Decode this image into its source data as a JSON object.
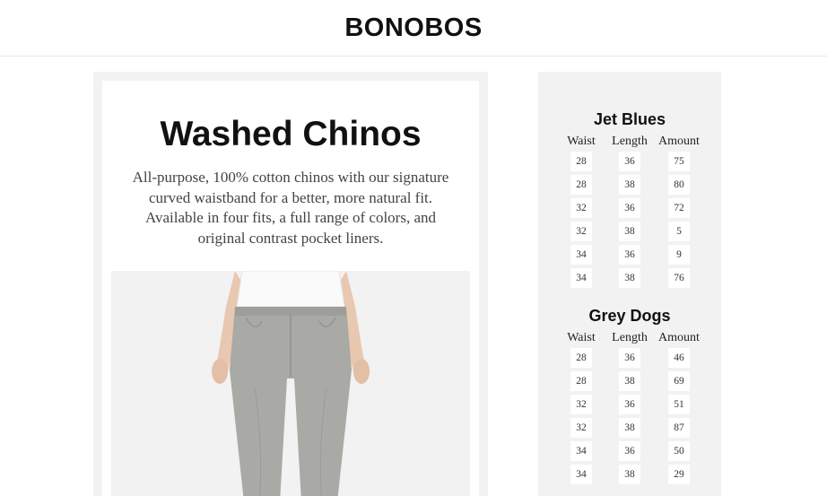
{
  "header": {
    "brand": "BONOBOS"
  },
  "product": {
    "title": "Washed Chinos",
    "description": "All-purpose, 100% cotton chinos with our signature curved waistband for a better, more natural fit. Available in four fits, a full range of colors, and original contrast pocket liners.",
    "image_icon": "pants-photo"
  },
  "inventory": {
    "columns": [
      "Waist",
      "Length",
      "Amount"
    ],
    "groups": [
      {
        "name": "Jet Blues",
        "rows": [
          [
            "28",
            "36",
            "75"
          ],
          [
            "28",
            "38",
            "80"
          ],
          [
            "32",
            "36",
            "72"
          ],
          [
            "32",
            "38",
            "5"
          ],
          [
            "34",
            "36",
            "9"
          ],
          [
            "34",
            "38",
            "76"
          ]
        ]
      },
      {
        "name": "Grey Dogs",
        "rows": [
          [
            "28",
            "36",
            "46"
          ],
          [
            "28",
            "38",
            "69"
          ],
          [
            "32",
            "36",
            "51"
          ],
          [
            "32",
            "38",
            "87"
          ],
          [
            "34",
            "36",
            "50"
          ],
          [
            "34",
            "38",
            "29"
          ]
        ]
      }
    ]
  },
  "colors": {
    "panel_bg": "#f2f2f2",
    "card_bg": "#ffffff",
    "pants": "#a9aaa5",
    "shirt": "#fafafa"
  }
}
